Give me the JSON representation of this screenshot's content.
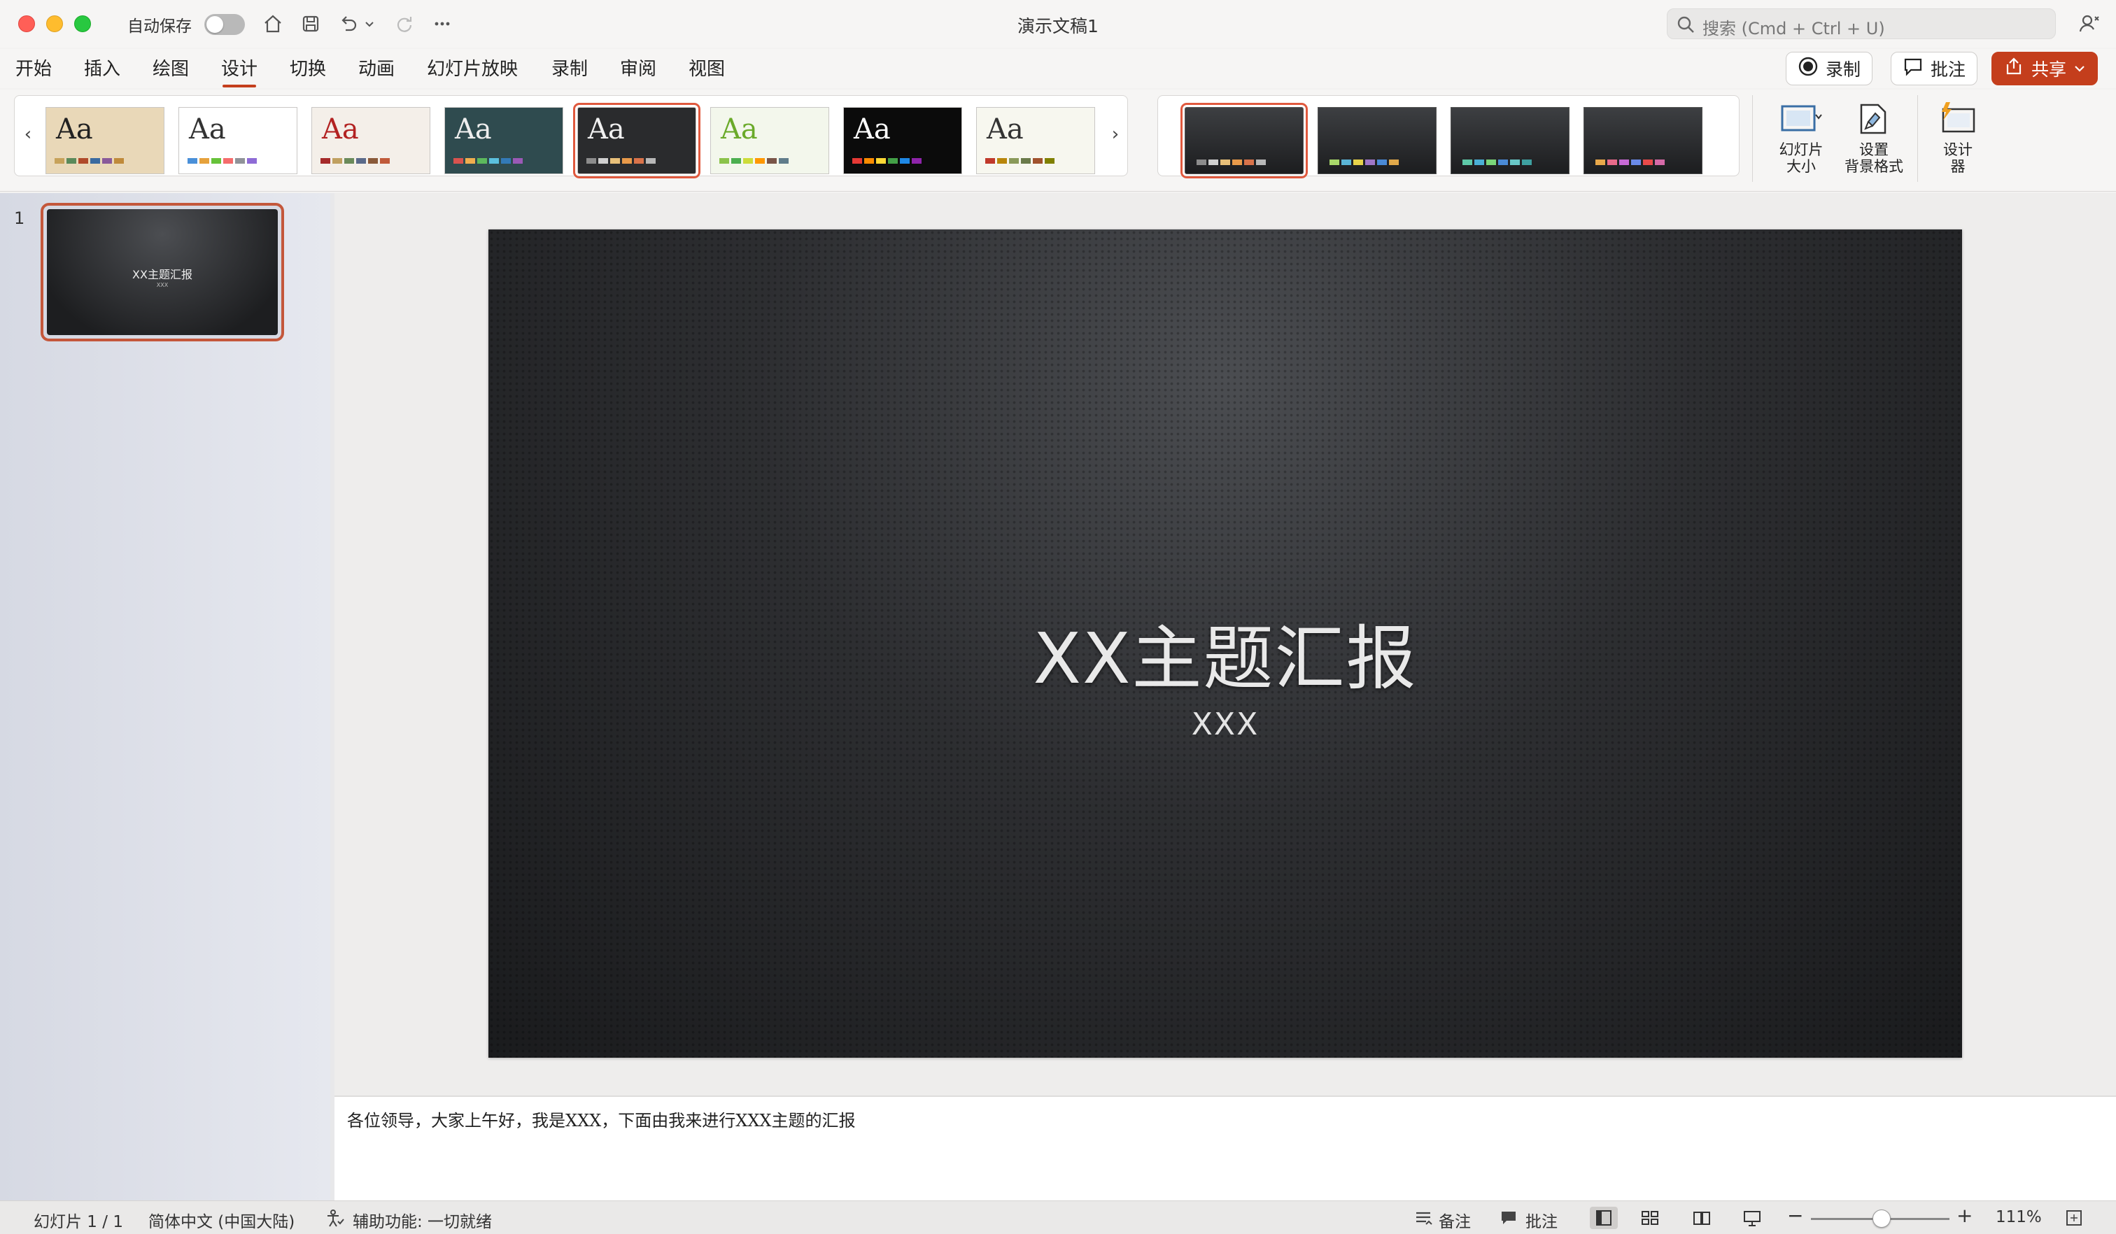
{
  "window": {
    "title": "演示文稿1",
    "autosave_label": "自动保存",
    "search_placeholder": "搜索 (Cmd + Ctrl + U)"
  },
  "menu_tabs": [
    "开始",
    "插入",
    "绘图",
    "设计",
    "切换",
    "动画",
    "幻灯片放映",
    "录制",
    "审阅",
    "视图"
  ],
  "active_tab": "设计",
  "header_buttons": {
    "record": "录制",
    "comments": "批注",
    "share": "共享"
  },
  "themes": [
    {
      "aa": "Aa",
      "bg": "#e9d8b8",
      "text": "#222",
      "swatches": [
        "#c7a25a",
        "#5a8a5a",
        "#b04a2a",
        "#3a6aa0",
        "#8a5a9a",
        "#c08a3a"
      ]
    },
    {
      "aa": "Aa",
      "bg": "#ffffff",
      "text": "#333",
      "swatches": [
        "#4a90d9",
        "#e6a23c",
        "#67c23a",
        "#f56c6c",
        "#909399",
        "#8e6bd6"
      ]
    },
    {
      "aa": "Aa",
      "bg": "#f4efe9",
      "text": "#b22222",
      "swatches": [
        "#a52a2a",
        "#c0a060",
        "#6a8a5a",
        "#5a6a8a",
        "#8a5a3a",
        "#c05a3a"
      ]
    },
    {
      "aa": "Aa",
      "bg": "#2f4b4f",
      "text": "#eeeeee",
      "swatches": [
        "#d9534f",
        "#f0ad4e",
        "#5cb85c",
        "#5bc0de",
        "#337ab7",
        "#9b59b6"
      ]
    },
    {
      "aa": "Aa",
      "bg": "#2a2b2d",
      "text": "#f0f0f0",
      "swatches": [
        "#8c8c8c",
        "#cfcfcf",
        "#e8c07a",
        "#e89a4a",
        "#d9734a",
        "#b8b8b8"
      ]
    },
    {
      "aa": "Aa",
      "bg": "#f3f7ec",
      "text": "#6aaa2a",
      "swatches": [
        "#8bc34a",
        "#4caf50",
        "#cddc39",
        "#ff9800",
        "#795548",
        "#607d8b"
      ]
    },
    {
      "aa": "Aa",
      "bg": "#0b0b0b",
      "text": "#ffffff",
      "swatches": [
        "#e53935",
        "#fb8c00",
        "#fdd835",
        "#43a047",
        "#1e88e5",
        "#8e24aa"
      ]
    },
    {
      "aa": "Aa",
      "bg": "#f7f7ef",
      "text": "#333",
      "swatches": [
        "#c0392b",
        "#b8860b",
        "#8a9a5a",
        "#6a7a4a",
        "#a0522d",
        "#808000"
      ]
    }
  ],
  "variants": [
    {
      "swatches": [
        "#8c8c8c",
        "#cfcfcf",
        "#e8c07a",
        "#e89a4a",
        "#d9734a",
        "#b8b8b8"
      ]
    },
    {
      "swatches": [
        "#a8d86a",
        "#5ab4d6",
        "#e7d34a",
        "#a077c8",
        "#4a8ad6",
        "#e0a84a"
      ]
    },
    {
      "swatches": [
        "#5ec9a8",
        "#4ab0d6",
        "#7ad67a",
        "#4a8ad6",
        "#68c7c7",
        "#3ea0a0"
      ]
    },
    {
      "swatches": [
        "#e8a84a",
        "#e86a8a",
        "#c86ad6",
        "#6a8ae8",
        "#e84a4a",
        "#d66aa8"
      ]
    }
  ],
  "ribbon_buttons": {
    "slide_size": [
      "幻灯片",
      "大小"
    ],
    "format_background": [
      "设置",
      "背景格式"
    ],
    "designer": [
      "设计",
      "器"
    ]
  },
  "slides_panel": {
    "number": "1",
    "thumb_title": "XX主题汇报",
    "thumb_subtitle": "XXX"
  },
  "slide": {
    "title": "XX主题汇报",
    "subtitle": "XXX"
  },
  "notes": "各位领导，大家上午好，我是XXX，下面由我来进行XXX主题的汇报",
  "status": {
    "slide_counter": "幻灯片 1 / 1",
    "language": "简体中文 (中国大陆)",
    "accessibility": "辅助功能: 一切就绪",
    "notes_btn": "备注",
    "comments_btn": "批注",
    "zoom": "111%"
  },
  "colors": {
    "accent": "#c43e1c",
    "selection": "#e0593e"
  }
}
